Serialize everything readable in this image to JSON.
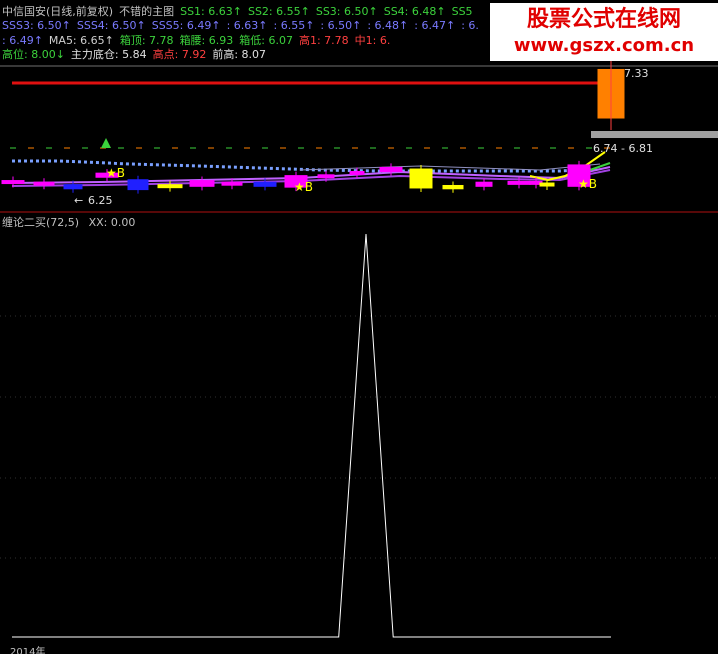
{
  "header": {
    "row1": [
      {
        "text": "中信国安(日线,前复权)",
        "color": "#c0c0c0"
      },
      {
        "text": "不错的主图",
        "color": "#c0c0c0"
      },
      {
        "text": "SS1: 6.63↑",
        "color": "#3cd23c"
      },
      {
        "text": "SS2: 6.55↑",
        "color": "#3cd23c"
      },
      {
        "text": "SS3: 6.50↑",
        "color": "#3cd23c"
      },
      {
        "text": "SS4: 6.48↑",
        "color": "#3cd23c"
      },
      {
        "text": "SS5",
        "color": "#3cd23c"
      }
    ],
    "row2": [
      {
        "text": "SSS3: 6.50↑",
        "color": "#7a7aff"
      },
      {
        "text": "SSS4: 6.50↑",
        "color": "#7a7aff"
      },
      {
        "text": "SSS5: 6.49↑",
        "color": "#7a7aff"
      },
      {
        "text": ": 6.63↑",
        "color": "#7a7aff"
      },
      {
        "text": ": 6.55↑",
        "color": "#7a7aff"
      },
      {
        "text": ": 6.50↑",
        "color": "#7a7aff"
      },
      {
        "text": ": 6.48↑",
        "color": "#7a7aff"
      },
      {
        "text": ": 6.47↑",
        "color": "#7a7aff"
      },
      {
        "text": ": 6.",
        "color": "#7a7aff"
      }
    ],
    "row3": [
      {
        "text": ": 6.49↑",
        "color": "#7a7aff"
      },
      {
        "text": "MA5: 6.65↑",
        "color": "#d0d0d0"
      },
      {
        "text": "箱顶: 7.78",
        "color": "#3cd23c"
      },
      {
        "text": "箱腰: 6.93",
        "color": "#3cd23c"
      },
      {
        "text": "箱低: 6.07",
        "color": "#3cd23c"
      },
      {
        "text": "高1: 7.78",
        "color": "#ff4040"
      },
      {
        "text": "中1: 6.",
        "color": "#ff4040"
      }
    ],
    "row4": [
      {
        "text": "高位: 8.00↓",
        "color": "#3cd23c"
      },
      {
        "text": "主力底仓: 5.84",
        "color": "#e0e0e0"
      },
      {
        "text": "高点: 7.92",
        "color": "#ff4040"
      },
      {
        "text": "前高: 8.07",
        "color": "#e0e0e0"
      }
    ]
  },
  "watermark": {
    "title": "股票公式在线网",
    "url": "www.gszx.com.cn"
  },
  "price_labels": {
    "top": "7.33",
    "range": "6.74 - 6.81",
    "low": "6.25"
  },
  "signal_marks": [
    "★B",
    "★B",
    "★B",
    "★B"
  ],
  "indicator": {
    "name": "缠论二买(72,5)",
    "xx_label": "XX: 0.00"
  },
  "footer": {
    "label": "2014年"
  },
  "colors": {
    "bg": "#000000",
    "axis": "#b01010",
    "grid": "#303030",
    "up": "#ff00ff",
    "down": "#2020ff",
    "hline": "#e01010",
    "yellow": "#ffff00",
    "orange": "#ff8000",
    "gray": "#a0a0a0"
  },
  "chart_data": [
    {
      "type": "candlestick",
      "title": "中信国安(日线,前复权)",
      "candles": [
        {
          "open": 6.55,
          "close": 6.57,
          "color": "magenta"
        },
        {
          "open": 6.55,
          "close": 6.55,
          "color": "magenta"
        },
        {
          "open": 6.47,
          "close": 6.52,
          "color": "blue"
        },
        {
          "open": 6.61,
          "close": 6.66,
          "color": "magenta"
        },
        {
          "open": 6.46,
          "close": 6.58,
          "color": "blue"
        },
        {
          "open": 6.5,
          "close": 6.52,
          "color": "yellow"
        },
        {
          "open": 6.5,
          "close": 6.57,
          "color": "magenta"
        },
        {
          "open": 6.54,
          "close": 6.55,
          "color": "magenta"
        },
        {
          "open": 6.5,
          "close": 6.55,
          "color": "blue"
        },
        {
          "open": 6.49,
          "close": 6.63,
          "color": "magenta"
        },
        {
          "open": 6.63,
          "close": 6.64,
          "color": "magenta"
        },
        {
          "open": 6.66,
          "close": 6.68,
          "color": "magenta"
        },
        {
          "open": 6.68,
          "close": 6.73,
          "color": "magenta"
        },
        {
          "open": 6.48,
          "close": 6.71,
          "color": "yellow"
        },
        {
          "open": 6.47,
          "close": 6.51,
          "color": "yellow"
        },
        {
          "open": 6.5,
          "close": 6.55,
          "color": "magenta"
        },
        {
          "open": 6.53,
          "close": 6.56,
          "color": "magenta"
        },
        {
          "open": 6.55,
          "close": 6.56,
          "color": "magenta"
        },
        {
          "open": 6.52,
          "close": 6.54,
          "color": "yellow"
        },
        {
          "open": 6.5,
          "close": 6.76,
          "color": "magenta"
        },
        {
          "open": 7.33,
          "close": 7.92,
          "color": "orange"
        }
      ],
      "horizontal_lines": [
        {
          "value": 7.78,
          "color": "red"
        }
      ]
    },
    {
      "type": "line",
      "title": "缠论二买(72,5)",
      "series": [
        {
          "name": "XX",
          "values": [
            0,
            0,
            0,
            0,
            0,
            0,
            0,
            0,
            0,
            0,
            0,
            0,
            0,
            1,
            0,
            0,
            0,
            0,
            0,
            0,
            0,
            0,
            0
          ]
        }
      ],
      "ylim": [
        0,
        1
      ]
    }
  ]
}
